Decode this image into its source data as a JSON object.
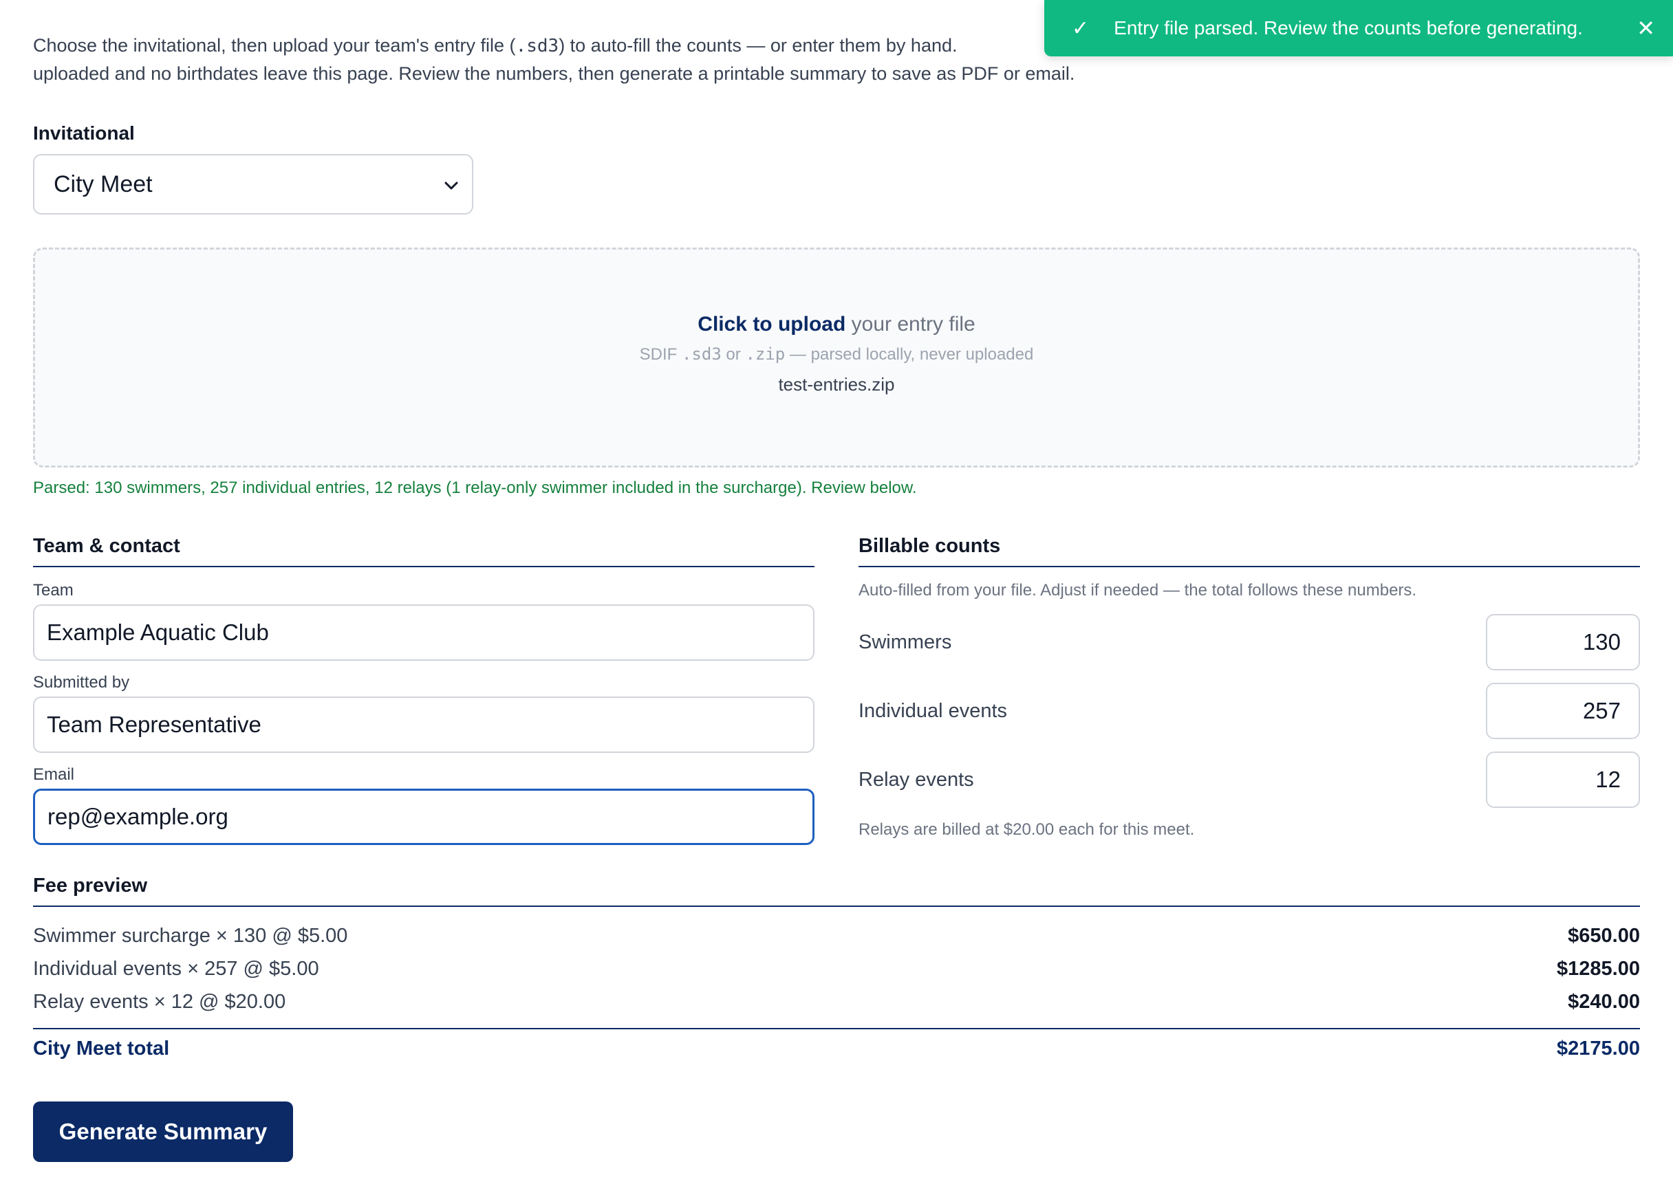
{
  "intro": {
    "part1": "Choose the invitational, then upload your team's entry file (",
    "code_ext": ".sd3",
    "part2": ") to auto-fill the counts — or enter them by hand. ",
    "line2": "uploaded and no birthdates leave this page. Review the numbers, then generate a printable summary to save as PDF or email."
  },
  "invitational": {
    "label": "Invitational",
    "selected": "City Meet"
  },
  "dropzone": {
    "cta": "Click to upload",
    "main_rest": " your entry file",
    "sub_prefix": "SDIF ",
    "ext_sd3": ".sd3",
    "sub_or": " or ",
    "ext_zip": ".zip",
    "sub_suffix": " — parsed locally, never uploaded",
    "filename": "test-entries.zip"
  },
  "parsed_message": "Parsed: 130 swimmers, 257 individual entries, 12 relays (1 relay-only swimmer included in the surcharge). Review below.",
  "team_contact": {
    "title": "Team & contact",
    "team_label": "Team",
    "team_value": "Example Aquatic Club",
    "submitted_label": "Submitted by",
    "submitted_value": "Team Representative",
    "email_label": "Email",
    "email_value": "rep@example.org"
  },
  "billable": {
    "title": "Billable counts",
    "help": "Auto-filled from your file. Adjust if needed — the total follows these numbers.",
    "rows": [
      {
        "label": "Swimmers",
        "value": "130"
      },
      {
        "label": "Individual events",
        "value": "257"
      },
      {
        "label": "Relay events",
        "value": "12"
      }
    ],
    "relay_note": "Relays are billed at $20.00 each for this meet."
  },
  "fee_preview": {
    "title": "Fee preview",
    "rows": [
      {
        "desc": "Swimmer surcharge × 130 @ $5.00",
        "amount": "$650.00"
      },
      {
        "desc": "Individual events × 257 @ $5.00",
        "amount": "$1285.00"
      },
      {
        "desc": "Relay events × 12 @ $20.00",
        "amount": "$240.00"
      }
    ],
    "total_label": "City Meet total",
    "total_amount": "$2175.00"
  },
  "generate_label": "Generate Summary",
  "toast": {
    "message": "Entry file parsed. Review the counts before generating.",
    "check": "✓",
    "close": "✕"
  },
  "colors": {
    "brand_navy": "#0b2a66",
    "toast_green": "#10b981",
    "success_text": "#15803d",
    "focus_blue": "#1d5fbf"
  }
}
